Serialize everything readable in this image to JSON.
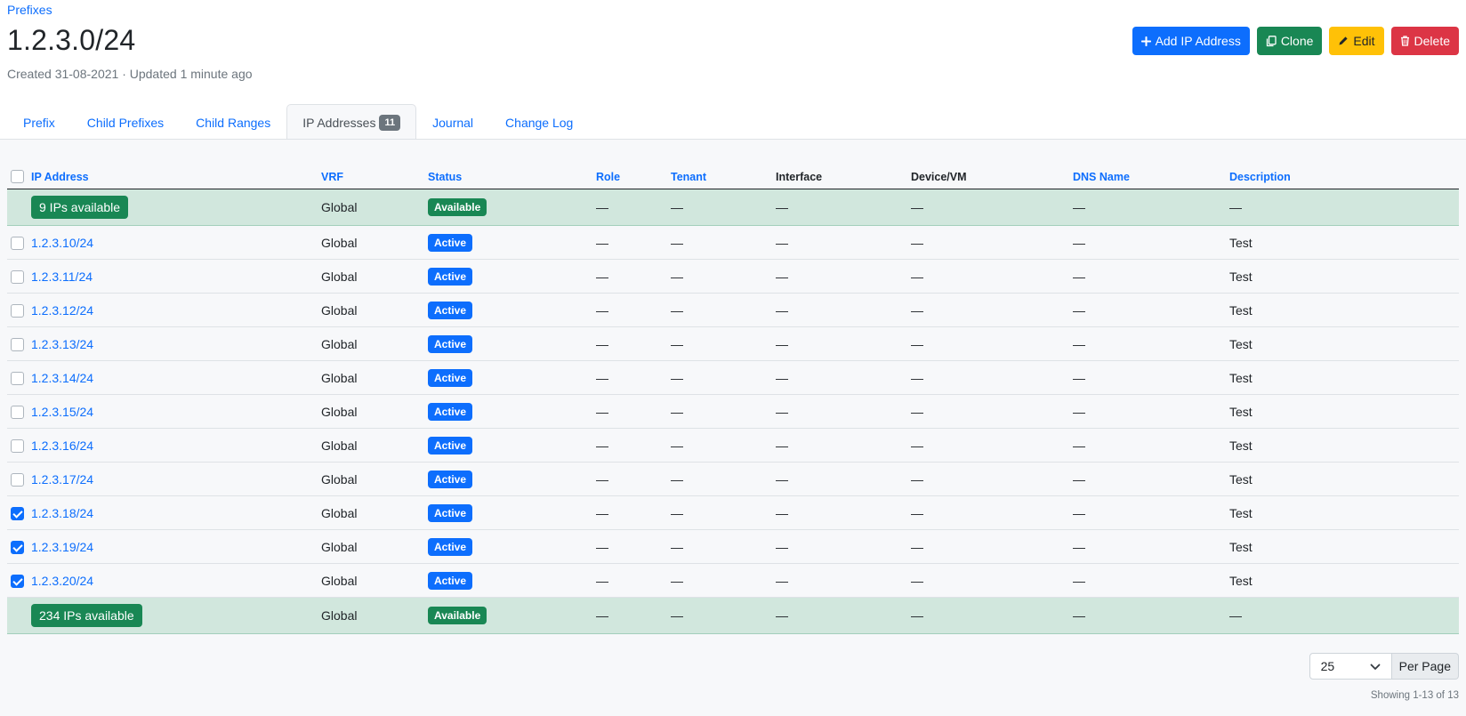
{
  "breadcrumb": "Prefixes",
  "title": "1.2.3.0/24",
  "meta": "Created 31-08-2021 · Updated 1 minute ago",
  "actions": {
    "add": "Add IP Address",
    "clone": "Clone",
    "edit": "Edit",
    "delete": "Delete"
  },
  "colors": {
    "primary": "#0d6efd",
    "success": "#198754",
    "warning": "#ffc107",
    "danger": "#dc3545",
    "available_row": "#d1e7dd"
  },
  "tabs": [
    {
      "label": "Prefix"
    },
    {
      "label": "Child Prefixes"
    },
    {
      "label": "Child Ranges"
    },
    {
      "label": "IP Addresses",
      "count": "11",
      "active": true
    },
    {
      "label": "Journal"
    },
    {
      "label": "Change Log"
    }
  ],
  "table": {
    "headers": [
      "IP Address",
      "VRF",
      "Status",
      "Role",
      "Tenant",
      "Interface",
      "Device/VM",
      "DNS Name",
      "Description"
    ],
    "rows": [
      {
        "type": "available",
        "ip": "9 IPs available",
        "vrf": "Global",
        "status": "Available",
        "role": "—",
        "tenant": "—",
        "interface": "—",
        "device": "—",
        "dns": "—",
        "description": "—"
      },
      {
        "type": "ip",
        "checked": false,
        "ip": "1.2.3.10/24",
        "vrf": "Global",
        "status": "Active",
        "role": "—",
        "tenant": "—",
        "interface": "—",
        "device": "—",
        "dns": "—",
        "description": "Test"
      },
      {
        "type": "ip",
        "checked": false,
        "ip": "1.2.3.11/24",
        "vrf": "Global",
        "status": "Active",
        "role": "—",
        "tenant": "—",
        "interface": "—",
        "device": "—",
        "dns": "—",
        "description": "Test"
      },
      {
        "type": "ip",
        "checked": false,
        "ip": "1.2.3.12/24",
        "vrf": "Global",
        "status": "Active",
        "role": "—",
        "tenant": "—",
        "interface": "—",
        "device": "—",
        "dns": "—",
        "description": "Test"
      },
      {
        "type": "ip",
        "checked": false,
        "ip": "1.2.3.13/24",
        "vrf": "Global",
        "status": "Active",
        "role": "—",
        "tenant": "—",
        "interface": "—",
        "device": "—",
        "dns": "—",
        "description": "Test"
      },
      {
        "type": "ip",
        "checked": false,
        "ip": "1.2.3.14/24",
        "vrf": "Global",
        "status": "Active",
        "role": "—",
        "tenant": "—",
        "interface": "—",
        "device": "—",
        "dns": "—",
        "description": "Test"
      },
      {
        "type": "ip",
        "checked": false,
        "ip": "1.2.3.15/24",
        "vrf": "Global",
        "status": "Active",
        "role": "—",
        "tenant": "—",
        "interface": "—",
        "device": "—",
        "dns": "—",
        "description": "Test"
      },
      {
        "type": "ip",
        "checked": false,
        "ip": "1.2.3.16/24",
        "vrf": "Global",
        "status": "Active",
        "role": "—",
        "tenant": "—",
        "interface": "—",
        "device": "—",
        "dns": "—",
        "description": "Test"
      },
      {
        "type": "ip",
        "checked": false,
        "ip": "1.2.3.17/24",
        "vrf": "Global",
        "status": "Active",
        "role": "—",
        "tenant": "—",
        "interface": "—",
        "device": "—",
        "dns": "—",
        "description": "Test"
      },
      {
        "type": "ip",
        "checked": true,
        "ip": "1.2.3.18/24",
        "vrf": "Global",
        "status": "Active",
        "role": "—",
        "tenant": "—",
        "interface": "—",
        "device": "—",
        "dns": "—",
        "description": "Test"
      },
      {
        "type": "ip",
        "checked": true,
        "ip": "1.2.3.19/24",
        "vrf": "Global",
        "status": "Active",
        "role": "—",
        "tenant": "—",
        "interface": "—",
        "device": "—",
        "dns": "—",
        "description": "Test"
      },
      {
        "type": "ip",
        "checked": true,
        "ip": "1.2.3.20/24",
        "vrf": "Global",
        "status": "Active",
        "role": "—",
        "tenant": "—",
        "interface": "—",
        "device": "—",
        "dns": "—",
        "description": "Test"
      },
      {
        "type": "available",
        "ip": "234 IPs available",
        "vrf": "Global",
        "status": "Available",
        "role": "—",
        "tenant": "—",
        "interface": "—",
        "device": "—",
        "dns": "—",
        "description": "—"
      }
    ]
  },
  "pagination": {
    "per_page_value": "25",
    "per_page_label": "Per Page",
    "showing": "Showing 1-13 of 13"
  }
}
